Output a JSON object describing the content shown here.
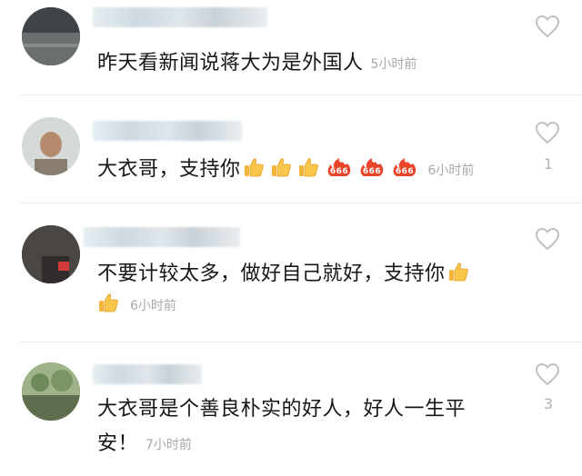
{
  "comments": [
    {
      "text": "昨天看新闻说蒋大为是外国人",
      "time": "5小时前",
      "like_count": ""
    },
    {
      "text": "大衣哥，支持你",
      "time": "6小时前",
      "like_count": "1",
      "emojis": [
        "thumbs-up",
        "thumbs-up",
        "thumbs-up",
        "fire-666",
        "fire-666",
        "fire-666"
      ]
    },
    {
      "text": "不要计较太多，做好自己就好，支持你",
      "time": "6小时前",
      "like_count": "",
      "emojis": [
        "thumbs-up",
        "thumbs-up"
      ]
    },
    {
      "text_line1": "大衣哥是个善良朴实的好人，好人一生平",
      "text_line2": "安！",
      "time": "7小时前",
      "like_count": "3"
    }
  ],
  "icons": {
    "like": "heart-outline-icon",
    "emoji_thumb": "thumbs-up-icon",
    "emoji_fire": "fire-666-icon"
  },
  "colors": {
    "text": "#161616",
    "time": "#a8a8a8",
    "heart": "#c0c0c0",
    "thumb": "#f4b63a",
    "fire": "#e8452a"
  }
}
